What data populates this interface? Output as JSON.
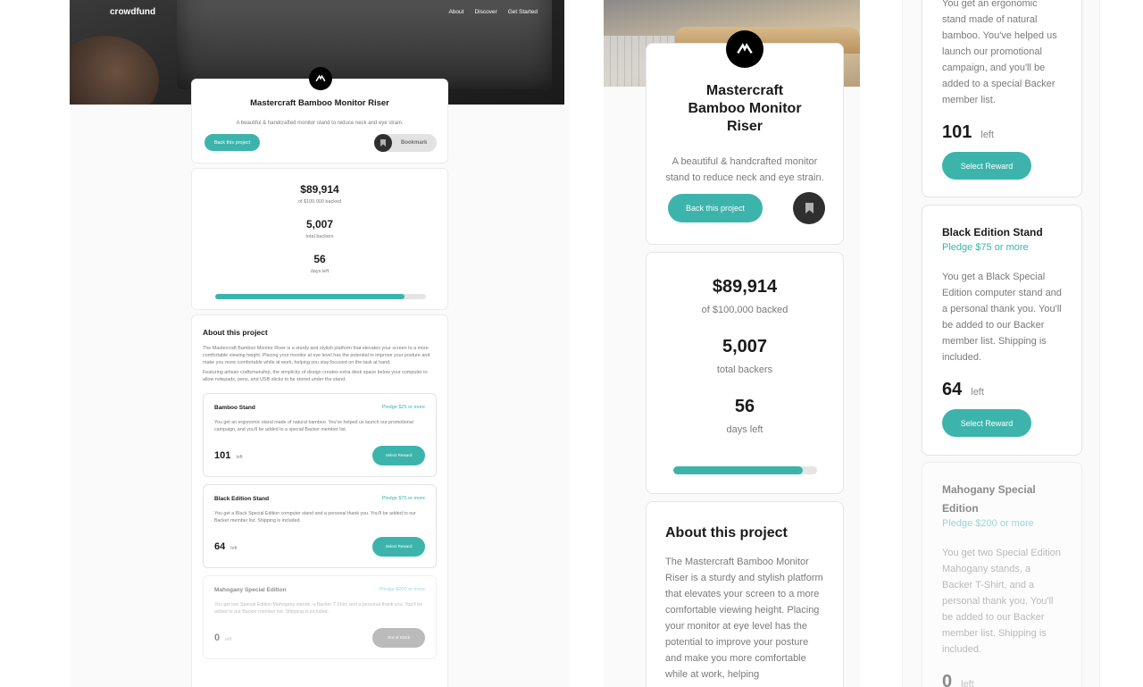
{
  "colors": {
    "accent": "#3cb4ac",
    "dark": "#2f2f2f",
    "muted": "#7a7a7a"
  },
  "nav": {
    "logo": "crowdfund",
    "links": [
      "About",
      "Discover",
      "Get Started"
    ]
  },
  "project": {
    "logo_icon": "mastercraft-logo-icon",
    "title": "Mastercraft Bamboo Monitor Riser",
    "subtitle": "A beautiful & handcrafted monitor stand to reduce neck and eye strain.",
    "back_button": "Back this project",
    "bookmark_label": "Bookmark"
  },
  "stats": {
    "backed_amount": "$89,914",
    "backed_label": "of $100,000 backed",
    "backers": "5,007",
    "backers_label": "total backers",
    "days": "56",
    "days_label": "days left",
    "progress_fraction": 0.899
  },
  "about": {
    "heading": "About this project",
    "paragraph1": "The Mastercraft Bamboo Monitor Riser is a sturdy and stylish platform that elevates your screen to a more comfortable viewing height. Placing your monitor at eye level has the potential to improve your posture and make you more comfortable while at work, helping you stay focused on the task at hand.",
    "paragraph2": "Featuring artisan craftsmanship, the simplicity of design creates extra desk space below your computer to allow notepads, pens, and USB sticks to be stored under the stand.",
    "mobile_paragraph1_visible": "The Mastercraft Bamboo Monitor Riser is a sturdy and stylish platform that elevates your screen to a more comfortable viewing height. Placing your monitor at eye level has the potential to improve your posture and make you more comfortable while at work, helping"
  },
  "rewards": [
    {
      "name": "Bamboo Stand",
      "pledge": "Pledge $25 or more",
      "description": "You get an ergonomic stand made of natural bamboo. You've helped us launch our promotional campaign, and you'll be added to a special Backer member list.",
      "left": "101",
      "left_label": "left",
      "button": "Select Reward"
    },
    {
      "name": "Black Edition Stand",
      "pledge": "Pledge $75 or more",
      "description": "You get a Black Special Edition computer stand and a personal thank you. You'll be added to our Backer member list. Shipping is included.",
      "left": "64",
      "left_label": "left",
      "button": "Select Reward"
    },
    {
      "name": "Mahogany Special Edition",
      "pledge": "Pledge $200 or more",
      "description": "You get two Special Edition Mahogany stands, a Backer T-Shirt, and a personal thank you. You'll be added to our Backer member list. Shipping is included.",
      "left": "0",
      "left_label": "left",
      "button": "Out of Stock"
    }
  ],
  "mobile_partial": {
    "bamboo_desc_visible": "You get an ergonomic stand made of natural bamboo. You've helped us launch our promotional campaign, and you'll be added to a special Backer member list."
  }
}
